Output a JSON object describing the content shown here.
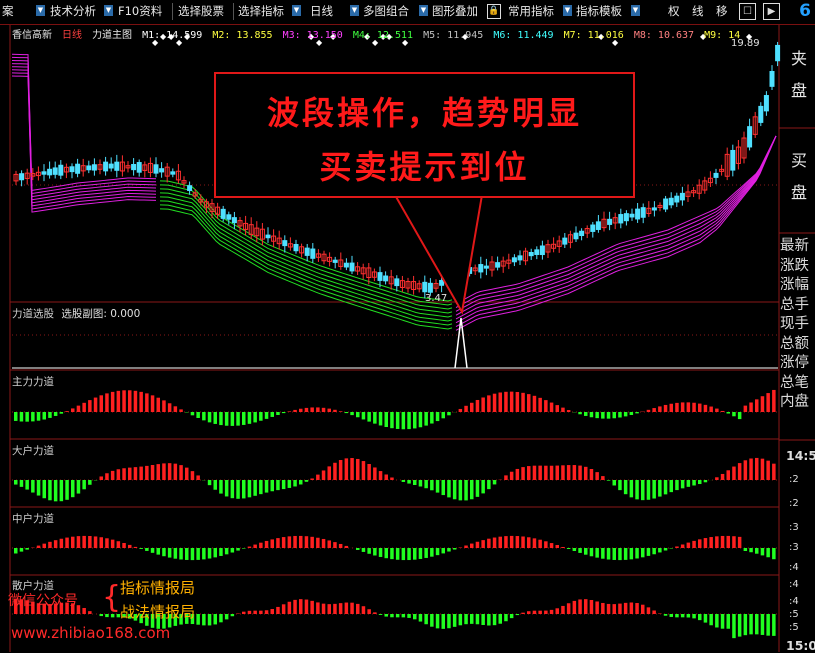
{
  "toolbar": {
    "items": [
      "案",
      "技术分析",
      "F10资料",
      "选择股票",
      "选择指标",
      "日线",
      "多图组合",
      "图形叠加",
      "常用指标",
      "指标模板"
    ],
    "quick": [
      "权",
      "线",
      "移"
    ],
    "badge": "6"
  },
  "main": {
    "title": "香信高新",
    "period": "日线",
    "indicator": "力道主图",
    "ma": [
      "M1: 14.599",
      "M2: 13.855",
      "M3: 13.150",
      "M4: 12.511",
      "M5: 11.945",
      "M6: 11.449",
      "M7: 11.016",
      "M8: 10.637",
      "M9: 14"
    ],
    "low_label": "3.47",
    "high_label": "19.89",
    "colors": {
      "up": "#ff3030",
      "down": "#4fe0ff",
      "ribbon_green": "#22e022",
      "ribbon_magenta": "#e020e0"
    }
  },
  "annotation": {
    "line1": "波段操作，趋势明显",
    "line2": "买卖提示到位"
  },
  "panels": [
    {
      "title": "力道选股",
      "subtitle": "选股副图: 0.000"
    },
    {
      "title": "主力力道"
    },
    {
      "title": "大户力道"
    },
    {
      "title": "中户力道"
    },
    {
      "title": "散户力道"
    }
  ],
  "right_panel": {
    "buttons": [
      "夹盘",
      "买盘"
    ],
    "fields": [
      "最新",
      "涨跌",
      "涨幅",
      "总手",
      "现手",
      "总额",
      "涨停",
      "总笔",
      "内盘"
    ],
    "time1": "14:5",
    "time2": "15:0",
    "col_nums": [
      ":2",
      ":2",
      ":3",
      ":3",
      ":4",
      ":4",
      ":4",
      ":5",
      ":5"
    ]
  },
  "watermark": {
    "label": "微信公众号",
    "line1": "指标情报局",
    "line2": "战法情报局",
    "url": "www.zhibiao168.com"
  }
}
